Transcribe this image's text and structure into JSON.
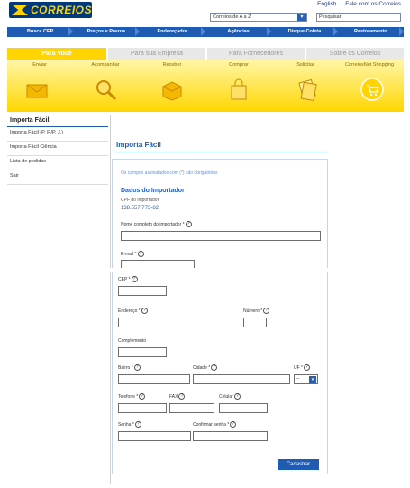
{
  "header": {
    "brand": "CORREIOS",
    "top_links": [
      "English",
      "Fale com os Correios"
    ],
    "dropdown_value": "Correios de A a Z",
    "search_placeholder": "Pesquisar"
  },
  "nav": [
    "Busca CEP",
    "Preços e Prazos",
    "Endereçador",
    "Agências",
    "Disque Coleta",
    "Rastreamento"
  ],
  "tabs": [
    "Para Você",
    "Para sua Empresa",
    "Para Fornecedores",
    "Sobre os Correios"
  ],
  "categories": [
    "Enviar",
    "Acompanhar",
    "Receber",
    "Comprar",
    "Solicitar",
    "CorreiosNet Shopping"
  ],
  "left_menu": {
    "title": "Importa Fácil",
    "items": [
      "Importa Fácil (P. F./P. J.)",
      "Importa Fácil Ciência",
      "Lista de pedidos",
      "Sair"
    ]
  },
  "main": {
    "title": "Importa Fácil",
    "info": "Os campos assinalados com (*) são obrigatórios",
    "section": "Dados do Importador",
    "cpf_label": "CPF do importador",
    "cpf_value": "138.557.773-82",
    "fields": {
      "nome": "Nome completo do importador *",
      "email": "E-mail *",
      "cep": "CEP *",
      "endereco": "Endereço *",
      "numero": "Número *",
      "complemento": "Complemento",
      "bairro": "Bairro *",
      "cidade": "Cidade *",
      "uf": "UF *",
      "uf_value": "--",
      "telefone": "Telefone *",
      "fax": "FAX",
      "celular": "Celular",
      "senha": "Senha *",
      "confirmar": "Confirmar senha *"
    },
    "submit": "Cadastrar"
  },
  "colors": {
    "brand_blue": "#1f5bb0",
    "brand_yellow": "#ffd400"
  }
}
